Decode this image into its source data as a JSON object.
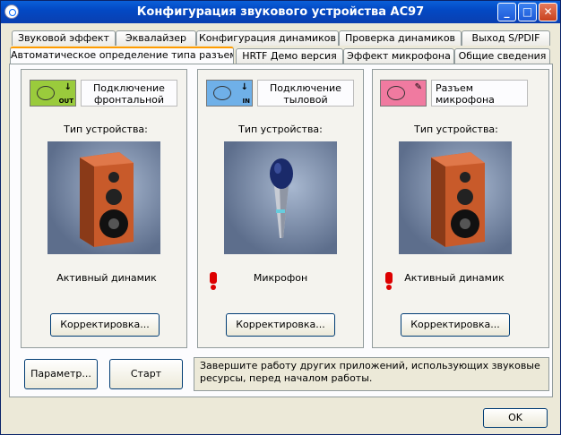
{
  "window": {
    "title": "Конфигурация звукового устройства АС97",
    "controls": {
      "minimize": "_",
      "maximize": "□",
      "close": "✕"
    }
  },
  "tabs_back": [
    "Звуковой эффект",
    "Эквалайзер",
    "Конфигурация динамиков",
    "Проверка динамиков",
    "Выход S/PDIF"
  ],
  "tabs_front": [
    "Автоматическое определение типа разъема",
    "HRTF Демо версия",
    "Эффект микрофона",
    "Общие сведения"
  ],
  "jacks": [
    {
      "label": "Подключение фронтальной",
      "type_label": "Тип устройства:",
      "device": "Активный динамик",
      "adjust_label": "Корректировка...",
      "warning": false,
      "jack_color": "#9acb3c",
      "jack_sub": "OUT"
    },
    {
      "label": "Подключение тыловой",
      "type_label": "Тип устройства:",
      "device": "Микрофон",
      "adjust_label": "Корректировка...",
      "warning": true,
      "jack_color": "#6fb0e8",
      "jack_sub": "IN"
    },
    {
      "label": "Разъем микрофона",
      "type_label": "Тип устройства:",
      "device": "Активный динамик",
      "adjust_label": "Корректировка...",
      "warning": true,
      "jack_color": "#f07aa0",
      "jack_sub": ""
    }
  ],
  "buttons": {
    "params": "Параметр...",
    "start": "Старт",
    "ok": "OK"
  },
  "message": "Завершите работу других приложений, использующих звуковые ресурсы, перед началом работы."
}
